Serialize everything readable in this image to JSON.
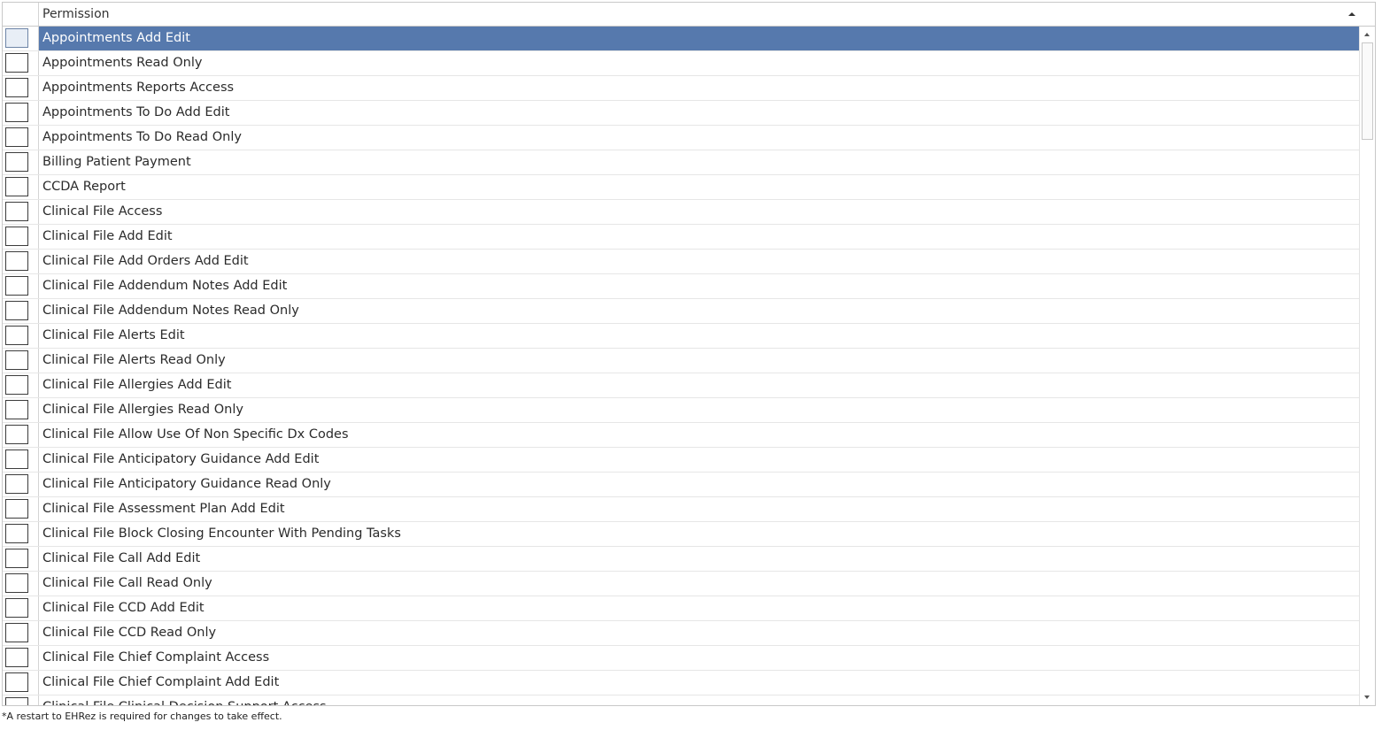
{
  "grid": {
    "column_header": "Permission",
    "sort": "ascending",
    "selected_index": 0,
    "rows": [
      {
        "label": "Appointments Add Edit",
        "checked": false
      },
      {
        "label": "Appointments Read Only",
        "checked": false
      },
      {
        "label": "Appointments Reports Access",
        "checked": false
      },
      {
        "label": "Appointments To Do Add Edit",
        "checked": false
      },
      {
        "label": "Appointments To Do Read Only",
        "checked": false
      },
      {
        "label": "Billing Patient Payment",
        "checked": false
      },
      {
        "label": "CCDA Report",
        "checked": false
      },
      {
        "label": "Clinical File Access",
        "checked": false
      },
      {
        "label": "Clinical File Add Edit",
        "checked": false
      },
      {
        "label": "Clinical File Add Orders Add Edit",
        "checked": false
      },
      {
        "label": "Clinical File Addendum Notes Add Edit",
        "checked": false
      },
      {
        "label": "Clinical File Addendum Notes Read Only",
        "checked": false
      },
      {
        "label": "Clinical File Alerts Edit",
        "checked": false
      },
      {
        "label": "Clinical File Alerts Read Only",
        "checked": false
      },
      {
        "label": "Clinical File Allergies Add Edit",
        "checked": false
      },
      {
        "label": "Clinical File Allergies Read Only",
        "checked": false
      },
      {
        "label": "Clinical File Allow Use Of Non Specific Dx Codes",
        "checked": false
      },
      {
        "label": "Clinical File Anticipatory Guidance Add Edit",
        "checked": false
      },
      {
        "label": "Clinical File Anticipatory Guidance Read Only",
        "checked": false
      },
      {
        "label": "Clinical File Assessment Plan Add Edit",
        "checked": false
      },
      {
        "label": "Clinical File Block Closing Encounter With Pending Tasks",
        "checked": false
      },
      {
        "label": "Clinical File Call Add Edit",
        "checked": false
      },
      {
        "label": "Clinical File Call Read Only",
        "checked": false
      },
      {
        "label": "Clinical File CCD Add Edit",
        "checked": false
      },
      {
        "label": "Clinical File CCD Read Only",
        "checked": false
      },
      {
        "label": "Clinical File Chief Complaint Access",
        "checked": false
      },
      {
        "label": "Clinical File Chief Complaint Add Edit",
        "checked": false
      },
      {
        "label": "Clinical File Clinical Decision Support Access",
        "checked": false
      }
    ]
  },
  "footer": {
    "note": "*A restart to EHRez is required for changes to take effect."
  },
  "colors": {
    "selection": "#5679ad",
    "border": "#c8c8c8"
  }
}
